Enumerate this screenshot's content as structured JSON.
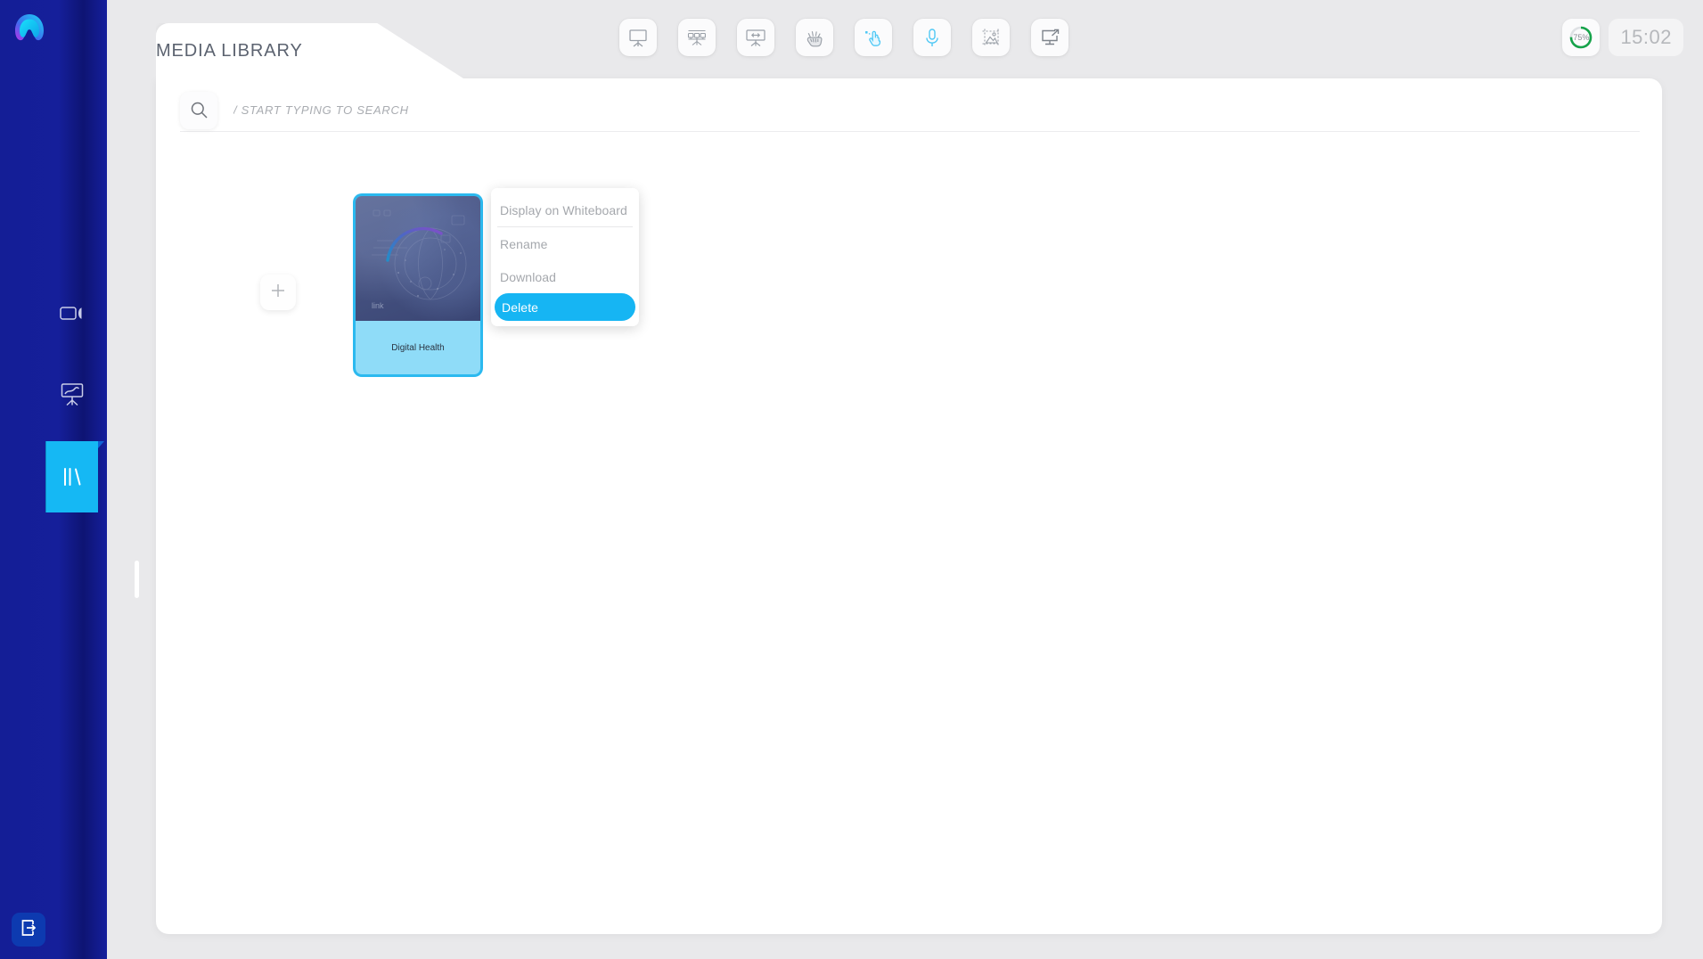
{
  "sidebar": {
    "logo_name": "app-logo",
    "items": [
      {
        "id": "video",
        "icon": "video-camera-icon",
        "label": "Video"
      },
      {
        "id": "whiteboard",
        "icon": "whiteboard-easel-icon",
        "label": "Whiteboard"
      },
      {
        "id": "library",
        "icon": "books-library-icon",
        "label": "Media Library",
        "active": true
      }
    ],
    "logout": {
      "icon": "logout-icon",
      "label": "Logout"
    }
  },
  "header": {
    "title": "MEDIA LIBRARY",
    "tools": [
      {
        "id": "present-screen",
        "icon": "whiteboard-screen-icon",
        "active": false
      },
      {
        "id": "screen-group",
        "icon": "multi-screen-icon",
        "active": false
      },
      {
        "id": "screen-share-arrows",
        "icon": "screen-share-icon",
        "active": false
      },
      {
        "id": "annotate-hand",
        "icon": "hand-draw-icon",
        "active": false
      },
      {
        "id": "pointer",
        "icon": "pointer-hand-icon",
        "active": true
      },
      {
        "id": "microphone",
        "icon": "microphone-icon",
        "active": false
      },
      {
        "id": "image-crop",
        "icon": "image-crop-icon",
        "active": false
      },
      {
        "id": "cast-screen",
        "icon": "cast-external-icon",
        "active": false
      }
    ],
    "battery": {
      "percent_label": "75%",
      "value": 75,
      "color": "#16a34a"
    },
    "clock": "15:02"
  },
  "search": {
    "icon": "search-icon",
    "value": "",
    "placeholder": "/ START TYPING TO SEARCH"
  },
  "grid": {
    "add_button": {
      "icon": "plus-icon",
      "label": "Add media"
    },
    "items": [
      {
        "id": "digital-health",
        "title": "Digital Health",
        "selected": true,
        "thumbnail_alt": "digital-health-thumbnail"
      }
    ]
  },
  "context_menu": {
    "visible": true,
    "items": [
      {
        "id": "display-on-whiteboard",
        "label": "Display on Whiteboard",
        "selected": false,
        "separator_after": true
      },
      {
        "id": "rename",
        "label": "Rename",
        "selected": false,
        "separator_after": false
      },
      {
        "id": "download",
        "label": "Download",
        "selected": false,
        "separator_after": false
      },
      {
        "id": "delete",
        "label": "Delete",
        "selected": true,
        "separator_after": false
      }
    ]
  },
  "colors": {
    "sidebar_blue": "#151f9a",
    "accent_cyan": "#16b5f3",
    "card_fill": "#8fdcf8",
    "battery_green": "#16a34a",
    "panel_white": "#ffffff"
  }
}
